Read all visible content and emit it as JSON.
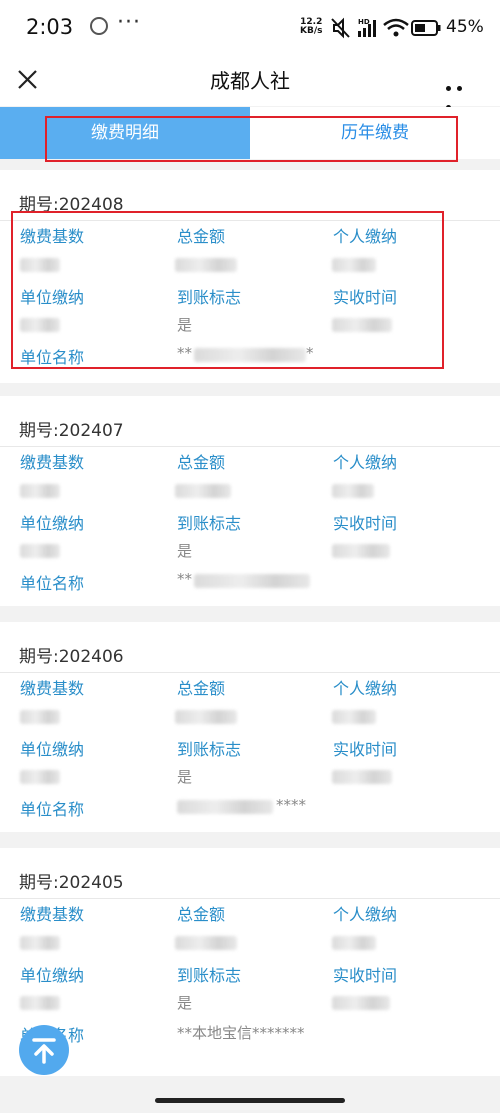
{
  "status_bar": {
    "time": "2:03",
    "more": "···",
    "speed_value": "12.2",
    "speed_unit": "KB/s",
    "hd_label": "HD",
    "battery": "45%"
  },
  "nav": {
    "title": "成都人社"
  },
  "tabs": [
    {
      "label": "缴费明细",
      "active": true
    },
    {
      "label": "历年缴费",
      "active": false
    }
  ],
  "labels": {
    "base": "缴费基数",
    "total": "总金额",
    "personal": "个人缴纳",
    "unit_pay": "单位缴纳",
    "arrival": "到账标志",
    "received_time": "实收时间",
    "unit_name": "单位名称"
  },
  "records": [
    {
      "period": "期号:202408",
      "arrival": "是",
      "unit_name_prefix": "**",
      "unit_name_suffix": "*"
    },
    {
      "period": "期号:202407",
      "arrival": "是",
      "unit_name_prefix": "**",
      "unit_name_suffix": ""
    },
    {
      "period": "期号:202406",
      "arrival": "是",
      "unit_name_prefix": "",
      "unit_name_suffix": "****"
    },
    {
      "period": "期号:202405",
      "arrival": "是",
      "unit_name": "**本地宝信*******"
    }
  ],
  "colors": {
    "accent": "#2a8ec9",
    "tab_active_bg": "#5aaef0",
    "highlight_box": "#e0212a"
  },
  "icons": {
    "close": "close-icon",
    "more": "more-dots-icon",
    "back_to_top": "arrow-up-to-top-icon"
  }
}
